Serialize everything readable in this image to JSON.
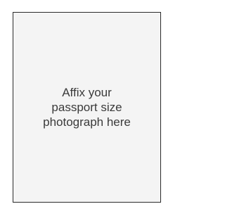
{
  "photo_box": {
    "instruction_lines": [
      "Affix your",
      "passport size",
      "photograph here"
    ]
  }
}
